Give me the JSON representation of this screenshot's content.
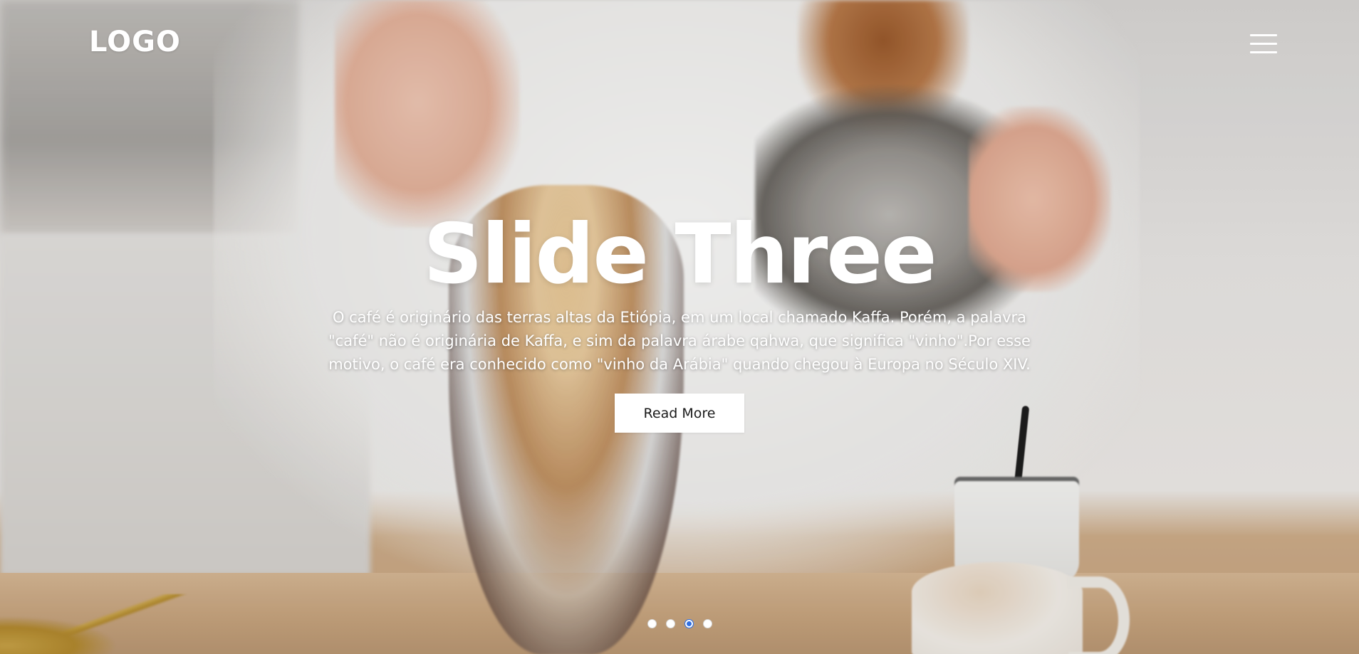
{
  "header": {
    "logo_text": "LOGO",
    "menu_icon": "hamburger-menu-icon"
  },
  "slide": {
    "title": "Slide Three",
    "description": "O café é originário das terras altas da Etiópia, em um local chamado Kaffa. Porém, a palavra \"café\" não é originária de Kaffa, e sim da palavra árabe qahwa, que significa \"vinho\".Por esse motivo, o café era conhecido como \"vinho da Arábia\" quando chegou à Europa no Século XIV.",
    "button_label": "Read More"
  },
  "pagination": {
    "total": 4,
    "active_index": 3
  },
  "colors": {
    "text": "#ffffff",
    "button_bg": "#ffffff",
    "button_text": "#1a1a1a",
    "active_dot": "#2f6fe3"
  }
}
